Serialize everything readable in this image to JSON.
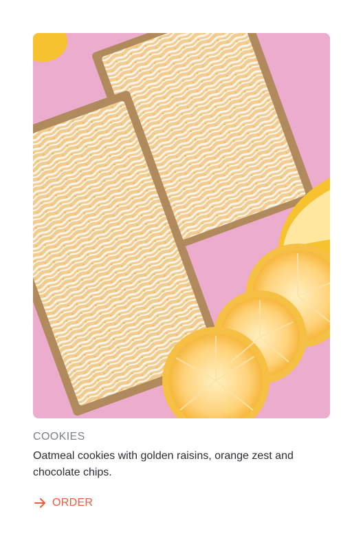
{
  "card": {
    "category": "COOKIES",
    "description": "Oatmeal cookies with golden raisins, orange zest and chocolate chips.",
    "cta_label": "ORDER",
    "cta_icon": "arrow-right-icon",
    "image_alt": "Two glazed lemon loaf cakes in paper trays with lemon slices on a pink background"
  },
  "colors": {
    "accent": "#ef5a3c",
    "category_text": "#7b7f8c",
    "body_text": "#2a2d33",
    "photo_background": "#e9a7c9"
  }
}
